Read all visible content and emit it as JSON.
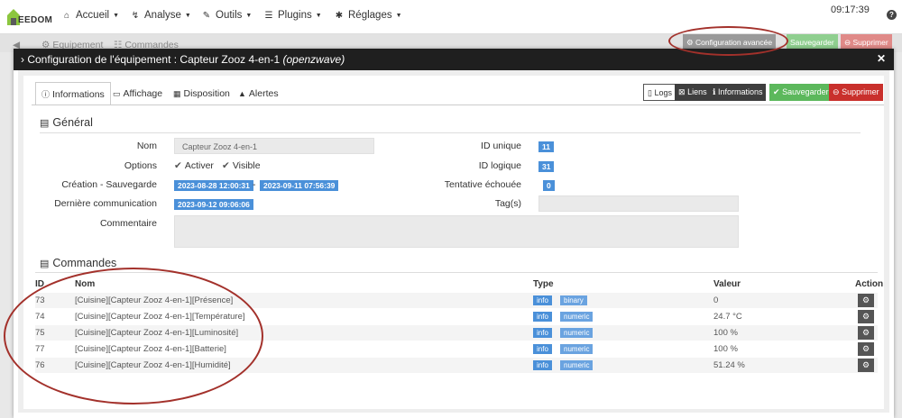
{
  "navbar": {
    "logo_text": "EEDOM",
    "items": [
      {
        "icon": "home-icon",
        "label": "Accueil"
      },
      {
        "icon": "analysis-icon",
        "label": "Analyse"
      },
      {
        "icon": "wrench-icon",
        "label": "Outils"
      },
      {
        "icon": "list-icon",
        "label": "Plugins"
      },
      {
        "icon": "gear-icon",
        "label": "Réglages"
      }
    ],
    "clock": "09:17:39"
  },
  "background": {
    "tabs": [
      "Equipement",
      "Commandes"
    ],
    "buttons": {
      "advanced": "Configuration avancée",
      "save": "Sauvegarder",
      "delete": "Supprimer"
    }
  },
  "modal": {
    "title": "Configuration de l'équipement : Capteur Zooz 4-en-1",
    "title_plugin": "(openzwave)",
    "tabs": [
      "Informations",
      "Affichage",
      "Disposition",
      "Alertes"
    ],
    "actions": {
      "logs": "Logs",
      "liens": "Liens",
      "informations": "Informations",
      "save": "Sauvegarder",
      "delete": "Supprimer"
    },
    "general": {
      "title": "Général",
      "nom_label": "Nom",
      "nom_value": "Capteur Zooz 4-en-1",
      "options_label": "Options",
      "opt_activer": "Activer",
      "opt_visible": "Visible",
      "creation_label": "Création - Sauvegarde",
      "creation_date": "2023-08-28 12:00:31",
      "separator": "-",
      "save_date": "2023-09-11 07:56:39",
      "lastcomm_label": "Dernière communication",
      "lastcomm_date": "2023-09-12 09:06:06",
      "comment_label": "Commentaire",
      "id_unique_label": "ID unique",
      "id_unique": "11",
      "id_logique_label": "ID logique",
      "id_logique": "31",
      "tentative_label": "Tentative échouée",
      "tentative": "0",
      "tags_label": "Tag(s)"
    },
    "commands": {
      "title": "Commandes",
      "headers": {
        "id": "ID",
        "nom": "Nom",
        "type": "Type",
        "valeur": "Valeur",
        "action": "Action"
      },
      "rows": [
        {
          "id": "73",
          "nom": "[Cuisine][Capteur Zooz 4-en-1][Présence]",
          "type": "info",
          "subtype": "binary",
          "valeur": "0"
        },
        {
          "id": "74",
          "nom": "[Cuisine][Capteur Zooz 4-en-1][Température]",
          "type": "info",
          "subtype": "numeric",
          "valeur": "24.7 °C"
        },
        {
          "id": "75",
          "nom": "[Cuisine][Capteur Zooz 4-en-1][Luminosité]",
          "type": "info",
          "subtype": "numeric",
          "valeur": "100 %"
        },
        {
          "id": "77",
          "nom": "[Cuisine][Capteur Zooz 4-en-1][Batterie]",
          "type": "info",
          "subtype": "numeric",
          "valeur": "100 %"
        },
        {
          "id": "76",
          "nom": "[Cuisine][Capteur Zooz 4-en-1][Humidité]",
          "type": "info",
          "subtype": "numeric",
          "valeur": "51.24 %"
        }
      ]
    }
  },
  "colors": {
    "accent": "#4a90d9",
    "success": "#5cb85c",
    "danger": "#d9534f",
    "annotation": "#a3312b"
  }
}
